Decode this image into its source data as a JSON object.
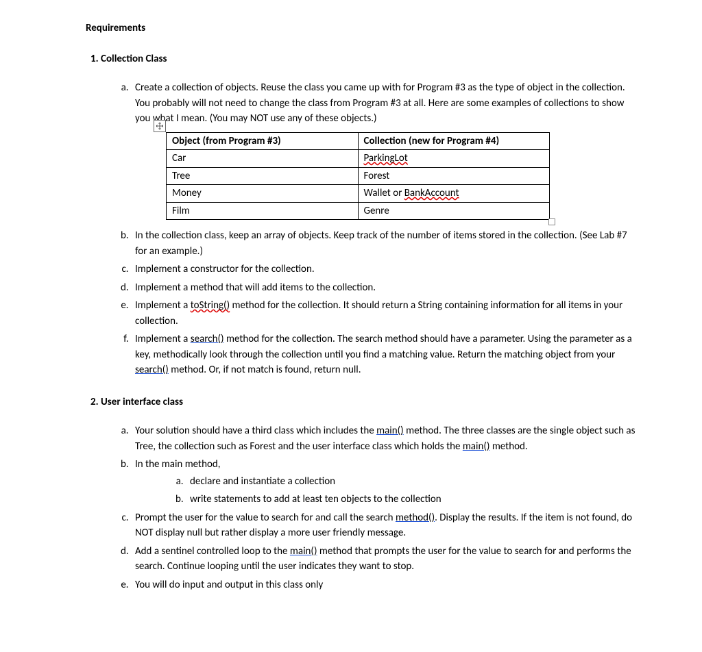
{
  "heading": "Requirements",
  "sections": [
    {
      "title": "Collection Class",
      "items": {
        "a": {
          "pre": "Create a collection of objects.  Reuse the class you came up with for Program #3 as the type of object in the collection.  You probably will not need to change the class from Program #3 at all.  Here are some examples of collections to show you what I mean.  (You may NOT use any of these objects.)",
          "table": {
            "head": [
              "Object (from Program #3)",
              "Collection (new for Program #4)"
            ],
            "rows": [
              {
                "obj": "Car",
                "coll_pre": "",
                "coll_wavy": "ParkingLot",
                "coll_post": ""
              },
              {
                "obj": "Tree",
                "coll_pre": "Forest",
                "coll_wavy": "",
                "coll_post": ""
              },
              {
                "obj": "Money",
                "coll_pre": "Wallet or ",
                "coll_wavy": "BankAccount",
                "coll_post": ""
              },
              {
                "obj": "Film",
                "coll_pre": "Genre",
                "coll_wavy": "",
                "coll_post": ""
              }
            ]
          }
        },
        "b": "In the collection class, keep an array of objects.  Keep track of the number of items stored in the collection.  (See Lab #7 for an example.)",
        "c": "Implement a constructor for the collection.",
        "d": "Implement a method that will add items to the collection.",
        "e": {
          "pre": "Implement a ",
          "u1": "toString()",
          "post": " method for the collection.  It should return a String containing information for all items in your collection."
        },
        "f": {
          "p1": "Implement a ",
          "u1": "search()",
          "p2": " method for the collection.  The search method should have a parameter.  Using the parameter as a key, methodically look through the collection until you find a matching value.  Return the matching object from your ",
          "u2": "search()",
          "p3": " method.  Or, if not match is found, return null."
        }
      }
    },
    {
      "title": "User interface class",
      "items": {
        "a": {
          "p1": "Your solution should have a third class which includes the ",
          "u1": "main()",
          "p2": " method.  The three classes are the single object such as Tree, the collection such as Forest and the user interface class which holds the ",
          "u2": "main()",
          "p3": " method."
        },
        "b": {
          "lead": "In the main method,",
          "inner_a": "declare and instantiate a collection",
          "inner_b": "write statements to add at least ten objects to the collection"
        },
        "c": {
          "p1": "Prompt the user for the value to search for and call the search ",
          "u1": "method()",
          "p2": ".  Display the results.  If the item is not found, do NOT display null but rather display a more user friendly message."
        },
        "d": {
          "p1": "Add a sentinel controlled loop to the ",
          "u1": "main()",
          "p2": " method that prompts the user for the value to search for and performs the search.  Continue looping until the user indicates they want to stop."
        },
        "e": "You will do input and output in this class only"
      }
    }
  ]
}
